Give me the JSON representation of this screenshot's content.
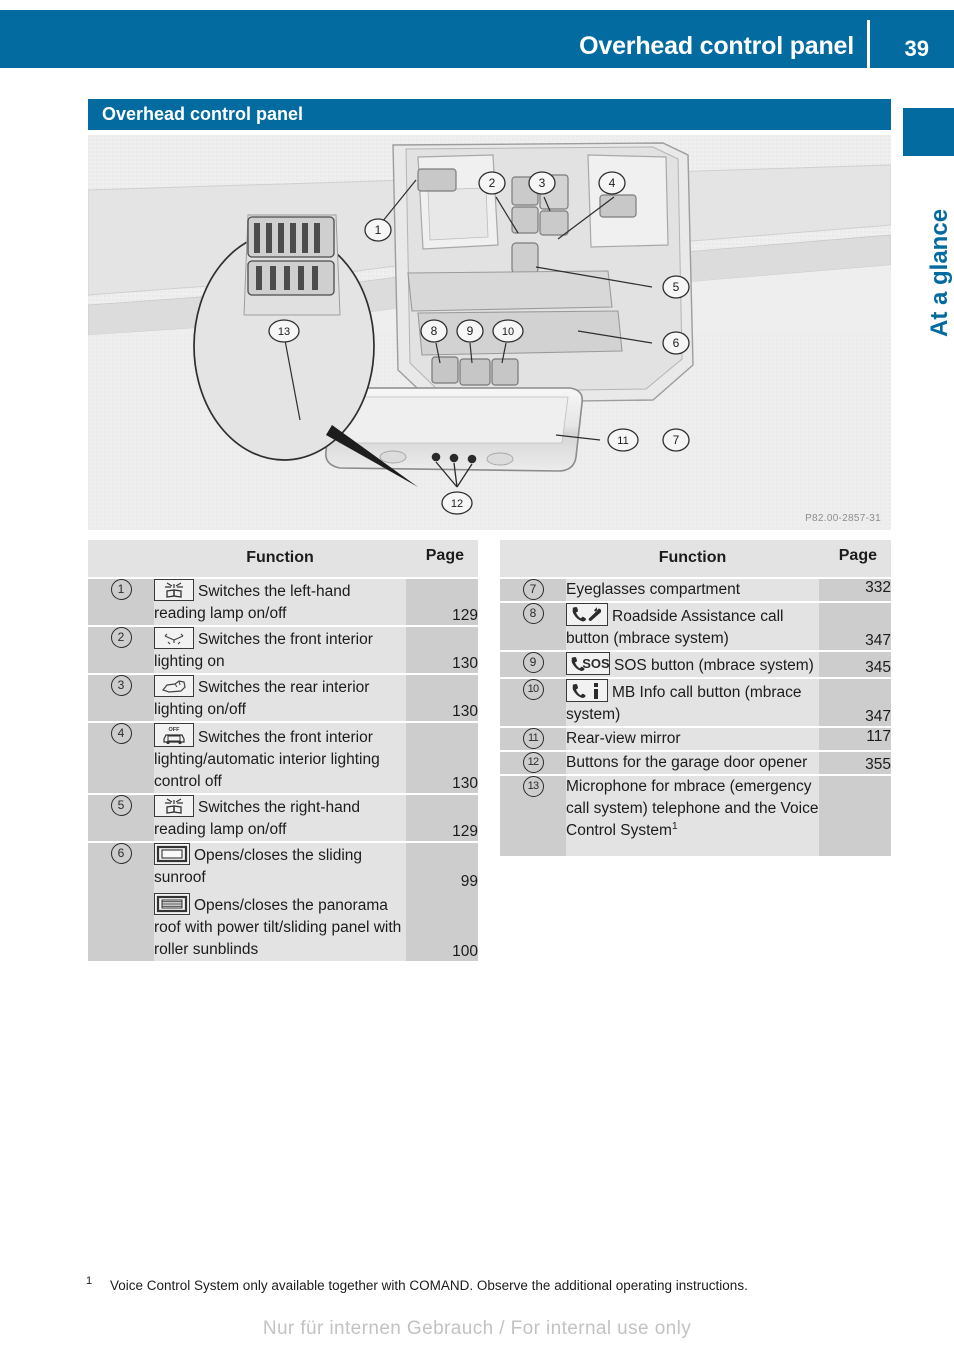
{
  "page": {
    "header_title": "Overhead control panel",
    "page_number": "39",
    "side_tab_label": "At a glance",
    "section_title": "Overhead control panel",
    "accent_color": "#046ba0",
    "row_num_bg": "#cdcdcd",
    "row_fn_bg": "#e3e3e3"
  },
  "figure": {
    "caption": "P82.00-2857-31",
    "callouts": [
      "1",
      "2",
      "3",
      "4",
      "5",
      "6",
      "7",
      "8",
      "9",
      "10",
      "11",
      "12",
      "13"
    ]
  },
  "tables": {
    "headers": {
      "col_num": "",
      "col_function": "Function",
      "col_page": "Page"
    },
    "left_rows": [
      {
        "num": "1",
        "icon": "reading-lamp-icon",
        "function": "Switches the left-hand reading lamp on/off",
        "page": "129"
      },
      {
        "num": "2",
        "icon": "front-interior-light-icon",
        "function": "Switches the front interior lighting on",
        "page": "130"
      },
      {
        "num": "3",
        "icon": "rear-interior-light-icon",
        "function": "Switches the rear interior lighting on/off",
        "page": "130"
      },
      {
        "num": "4",
        "icon": "interior-light-off-icon",
        "function": "Switches the front interior lighting/automatic interior lighting control off",
        "page": "130"
      },
      {
        "num": "5",
        "icon": "reading-lamp-icon",
        "function": "Switches the right-hand reading lamp on/off",
        "page": "129"
      },
      {
        "num": "6",
        "icon": "sliding-sunroof-icon",
        "function": "Opens/closes the sliding sunroof",
        "page": "99",
        "icon2": "panorama-roof-icon",
        "function2": "Opens/closes the panorama roof with power tilt/sliding panel with roller sunblinds",
        "page2": "100"
      }
    ],
    "right_rows": [
      {
        "num": "7",
        "icon": "",
        "function": "Eyeglasses compartment",
        "page": "332"
      },
      {
        "num": "8",
        "icon": "roadside-assistance-icon",
        "function": "Roadside Assistance call button (mbrace system)",
        "page": "347"
      },
      {
        "num": "9",
        "icon": "sos-button-icon",
        "icon_text": "SOS",
        "function": "SOS button (mbrace system)",
        "page": "345"
      },
      {
        "num": "10",
        "icon": "mb-info-call-icon",
        "function": "MB Info call button (mbrace system)",
        "page": "347"
      },
      {
        "num": "11",
        "icon": "",
        "function": "Rear-view mirror",
        "page": "117"
      },
      {
        "num": "12",
        "icon": "",
        "function": "Buttons for the garage door opener",
        "page": "355"
      },
      {
        "num": "13",
        "icon": "",
        "function": "Microphone for mbrace (emergency call system) telephone and the Voice Control System",
        "function_sup": "1",
        "page": ""
      }
    ]
  },
  "footnote": {
    "mark": "1",
    "text": "Voice Control System only available together with COMAND. Observe the additional operating instructions."
  },
  "watermark": "Nur für internen Gebrauch / For internal use only"
}
